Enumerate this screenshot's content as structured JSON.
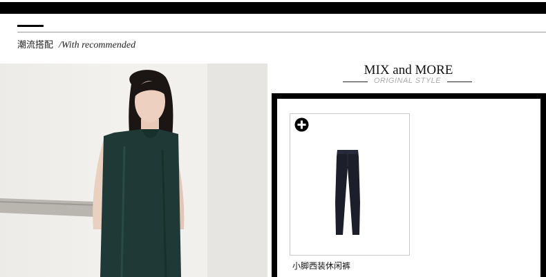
{
  "section": {
    "title_cn": "潮流搭配",
    "title_en": "/With recommended"
  },
  "mix": {
    "title": "MIX and MORE",
    "subtitle": "ORIGINAL STYLE"
  },
  "products": [
    {
      "name": "小脚西装休闲裤",
      "icon": "plus-circle-icon",
      "image": "trousers"
    }
  ],
  "colors": {
    "bar": "#000000",
    "dress": "#1f3a36",
    "pants": "#1c1f2a",
    "subtitle": "#aaaaaa"
  }
}
